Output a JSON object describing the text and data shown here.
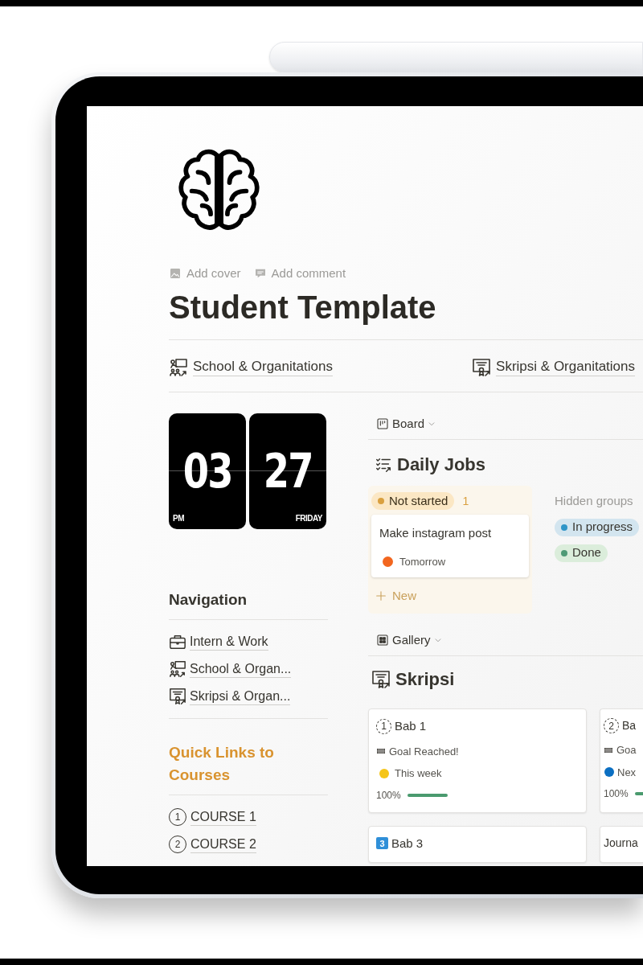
{
  "page": {
    "actions": [
      {
        "kind": "cover",
        "label": "Add cover"
      },
      {
        "kind": "comment",
        "label": "Add comment"
      }
    ],
    "title": "Student Template",
    "links": [
      {
        "kind": "school",
        "label": "School & Organitations"
      },
      {
        "kind": "certificate",
        "label": "Skripsi & Organitations"
      }
    ]
  },
  "clock": {
    "hour": "03",
    "minute": "27",
    "period": "PM",
    "day": "FRIDAY"
  },
  "navigation": {
    "heading": "Navigation",
    "items": [
      {
        "kind": "briefcase",
        "label": "Intern & Work"
      },
      {
        "kind": "school",
        "label": "School & Organ..."
      },
      {
        "kind": "certificate",
        "label": "Skripsi & Organ..."
      }
    ]
  },
  "quick_links": {
    "heading": "Quick Links to Courses",
    "items": [
      {
        "number": "1",
        "label": "COURSE 1"
      },
      {
        "number": "2",
        "label": "COURSE 2"
      }
    ]
  },
  "board": {
    "view": "Board",
    "title": "Daily Jobs",
    "group": {
      "label": "Not started",
      "color": "#d9a03f",
      "count": "1",
      "new_label": "New",
      "cards": [
        {
          "title": "Make instagram post",
          "date": {
            "label": "Tomorrow",
            "color": "#f2661f"
          }
        }
      ]
    },
    "hidden_label": "Hidden groups",
    "hidden_groups": [
      {
        "label": "In progress",
        "color": "#2f95c7"
      },
      {
        "label": "Done",
        "color": "#4f9a76"
      }
    ]
  },
  "gallery": {
    "view": "Gallery",
    "title": "Skripsi",
    "cards": [
      {
        "badge": {
          "kind": "circle",
          "number": "1"
        },
        "title": "Bab 1",
        "status": "Goal Reached!",
        "when": {
          "label": "This week",
          "color": "#f5c518"
        },
        "percent": "100%"
      },
      {
        "badge": {
          "kind": "circle",
          "number": "2"
        },
        "title": "Ba",
        "status": "Goa",
        "when": {
          "label": "Nex",
          "color": "#0b6fc2"
        },
        "percent": "100%"
      },
      {
        "badge": {
          "kind": "square",
          "number": "3"
        },
        "title": "Bab 3"
      },
      {
        "title": "Journa"
      }
    ]
  }
}
